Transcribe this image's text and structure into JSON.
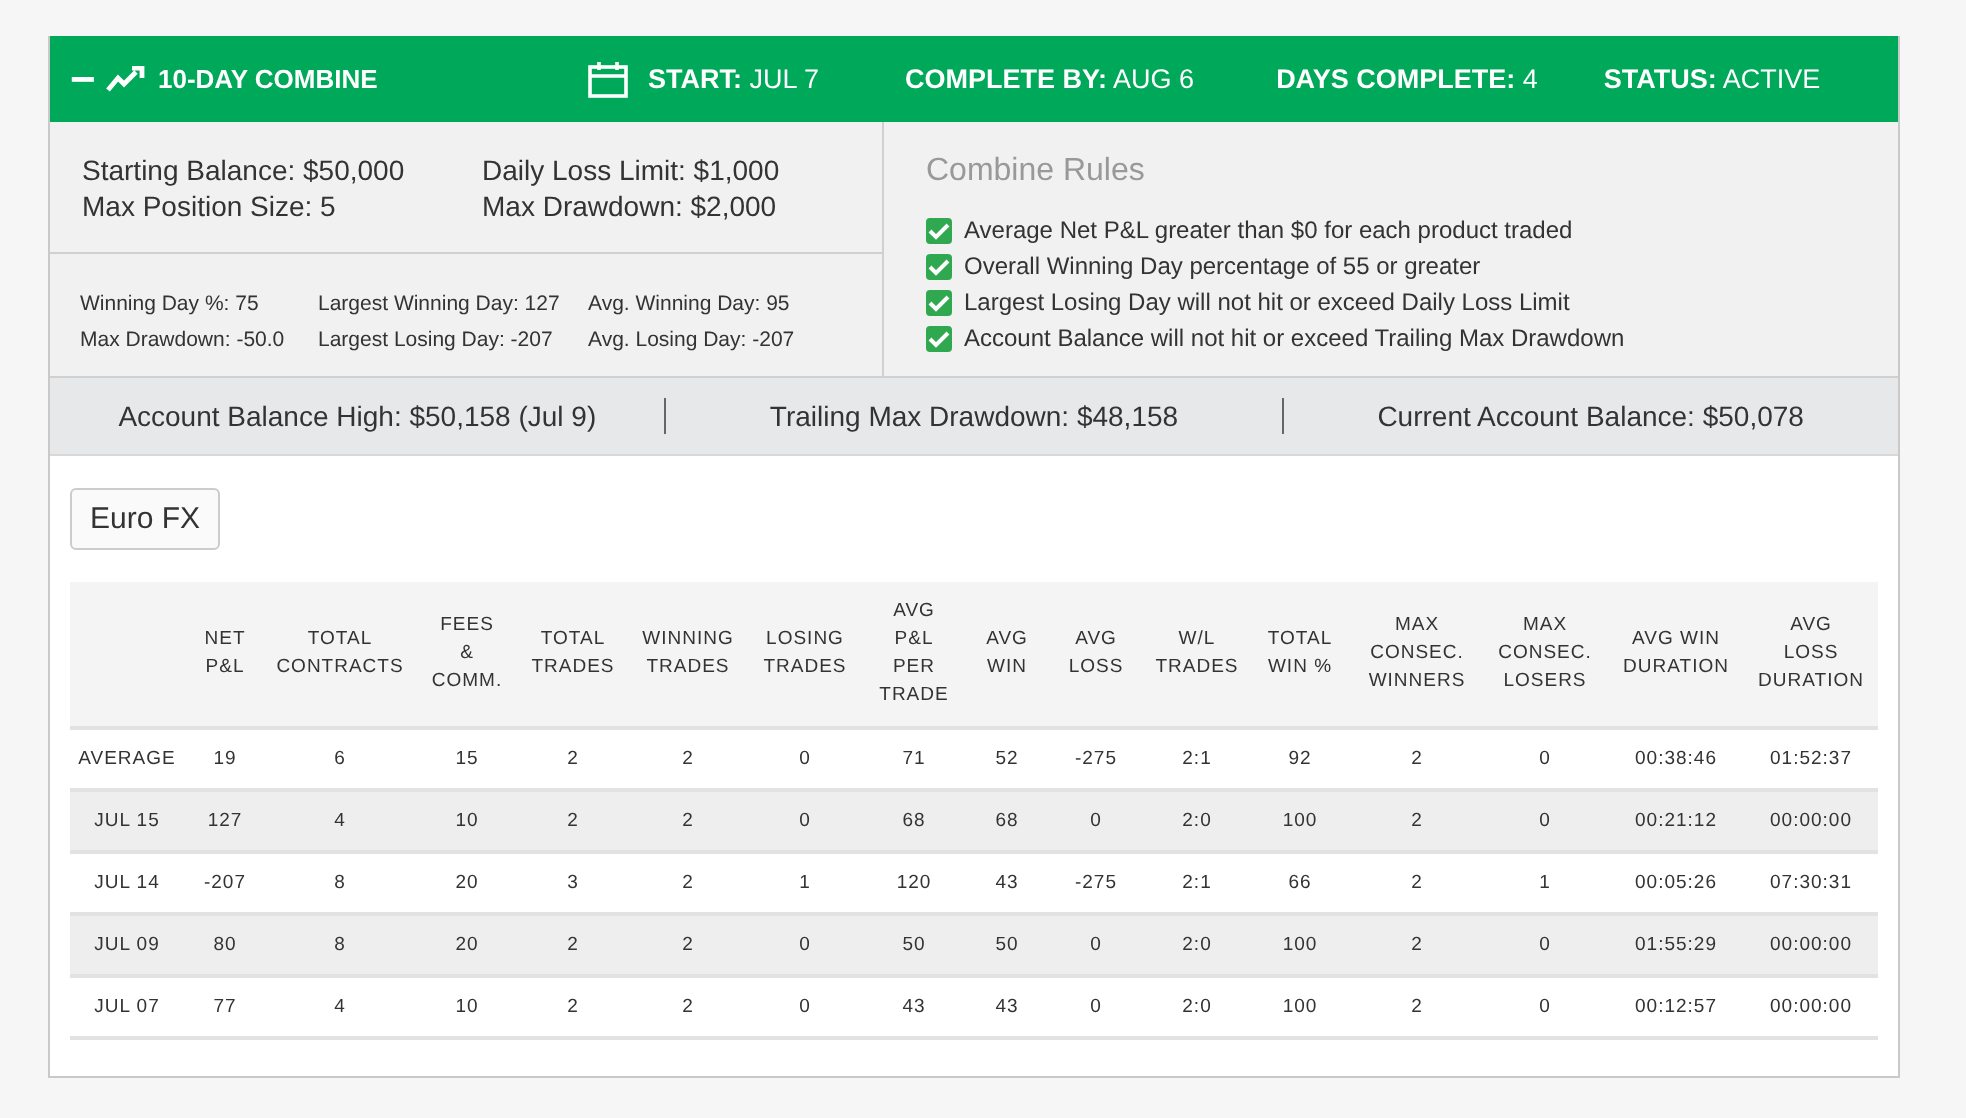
{
  "header": {
    "collapse_glyph": "−",
    "title": "10-DAY COMBINE",
    "stats": [
      {
        "label": "START:",
        "value": "JUL 7",
        "kind": "calendar"
      },
      {
        "label": "COMPLETE BY:",
        "value": "AUG 6",
        "kind": "plain"
      },
      {
        "label": "DAYS COMPLETE:",
        "value": "4",
        "kind": "plain"
      },
      {
        "label": "STATUS:",
        "value": "ACTIVE",
        "kind": "plain"
      }
    ]
  },
  "account_rules": [
    [
      "Starting Balance: $50,000",
      "Max Position Size: 5"
    ],
    [
      "Daily Loss Limit: $1,000",
      "Max Drawdown: $2,000"
    ]
  ],
  "day_stats": [
    [
      "Winning Day %: 75",
      "Max Drawdown: -50.0"
    ],
    [
      "Largest Winning Day: 127",
      "Largest Losing Day: -207"
    ],
    [
      "Avg. Winning Day: 95",
      "Avg. Losing Day: -207"
    ]
  ],
  "combine_rules": {
    "title": "Combine Rules",
    "items": [
      {
        "text": "Average Net P&L greater than $0 for each product traded",
        "checked": true
      },
      {
        "text": "Overall Winning Day percentage of 55 or greater",
        "checked": true
      },
      {
        "text": "Largest Losing Day will not hit or exceed Daily Loss Limit",
        "checked": true
      },
      {
        "text": "Account Balance will not hit or exceed Trailing Max Drawdown",
        "checked": true
      }
    ]
  },
  "balance_bar": [
    "Account Balance High: $50,158 (Jul 9)",
    "Trailing Max Drawdown: $48,158",
    "Current Account Balance: $50,078"
  ],
  "product_button": "Euro FX",
  "table": {
    "columns": [
      "",
      "NET\nP&L",
      "TOTAL\nCONTRACTS",
      "FEES\n&\nCOMM.",
      "TOTAL\nTRADES",
      "WINNING\nTRADES",
      "LOSING\nTRADES",
      "AVG\nP&L\nPER\nTRADE",
      "AVG\nWIN",
      "AVG\nLOSS",
      "W/L\nTRADES",
      "TOTAL\nWIN %",
      "MAX\nCONSEC.\nWINNERS",
      "MAX\nCONSEC.\nLOSERS",
      "AVG WIN\nDURATION",
      "AVG\nLOSS\nDURATION"
    ],
    "rows": [
      [
        "AVERAGE",
        "19",
        "6",
        "15",
        "2",
        "2",
        "0",
        "71",
        "52",
        "-275",
        "2:1",
        "92",
        "2",
        "0",
        "00:38:46",
        "01:52:37"
      ],
      [
        "JUL 15",
        "127",
        "4",
        "10",
        "2",
        "2",
        "0",
        "68",
        "68",
        "0",
        "2:0",
        "100",
        "2",
        "0",
        "00:21:12",
        "00:00:00"
      ],
      [
        "JUL 14",
        "-207",
        "8",
        "20",
        "3",
        "2",
        "1",
        "120",
        "43",
        "-275",
        "2:1",
        "66",
        "2",
        "1",
        "00:05:26",
        "07:30:31"
      ],
      [
        "JUL 09",
        "80",
        "8",
        "20",
        "2",
        "2",
        "0",
        "50",
        "50",
        "0",
        "2:0",
        "100",
        "2",
        "0",
        "01:55:29",
        "00:00:00"
      ],
      [
        "JUL 07",
        "77",
        "4",
        "10",
        "2",
        "2",
        "0",
        "43",
        "43",
        "0",
        "2:0",
        "100",
        "2",
        "0",
        "00:12:57",
        "00:00:00"
      ]
    ]
  }
}
